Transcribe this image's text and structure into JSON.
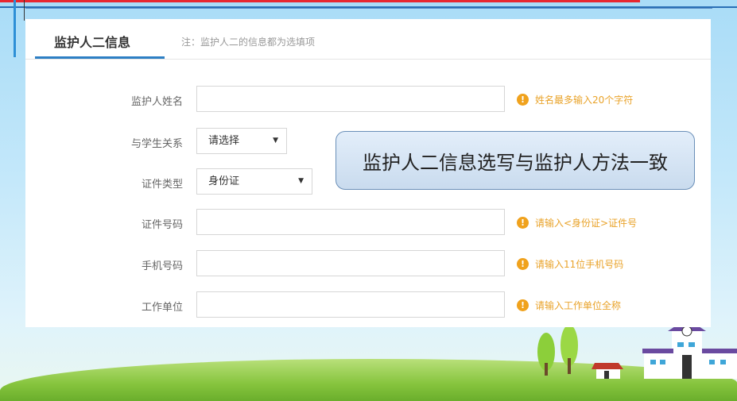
{
  "tab": {
    "title": "监护人二信息",
    "note": "注：监护人二的信息都为选填项"
  },
  "fields": {
    "name": {
      "label": "监护人姓名",
      "value": "",
      "hint": "姓名最多输入20个字符"
    },
    "relation": {
      "label": "与学生关系",
      "selected": "请选择"
    },
    "id_type": {
      "label": "证件类型",
      "selected": "身份证"
    },
    "id_number": {
      "label": "证件号码",
      "value": "",
      "hint": "请输入<身份证>证件号"
    },
    "phone": {
      "label": "手机号码",
      "value": "",
      "hint": "请输入11位手机号码"
    },
    "employer": {
      "label": "工作单位",
      "value": "",
      "hint": "请输入工作单位全称"
    }
  },
  "callout": {
    "text": "监护人二信息选写与监护人方法一致"
  },
  "colors": {
    "accent": "#2d7fc4",
    "hint": "#e9a32a",
    "top_bar": "#e8262f"
  }
}
